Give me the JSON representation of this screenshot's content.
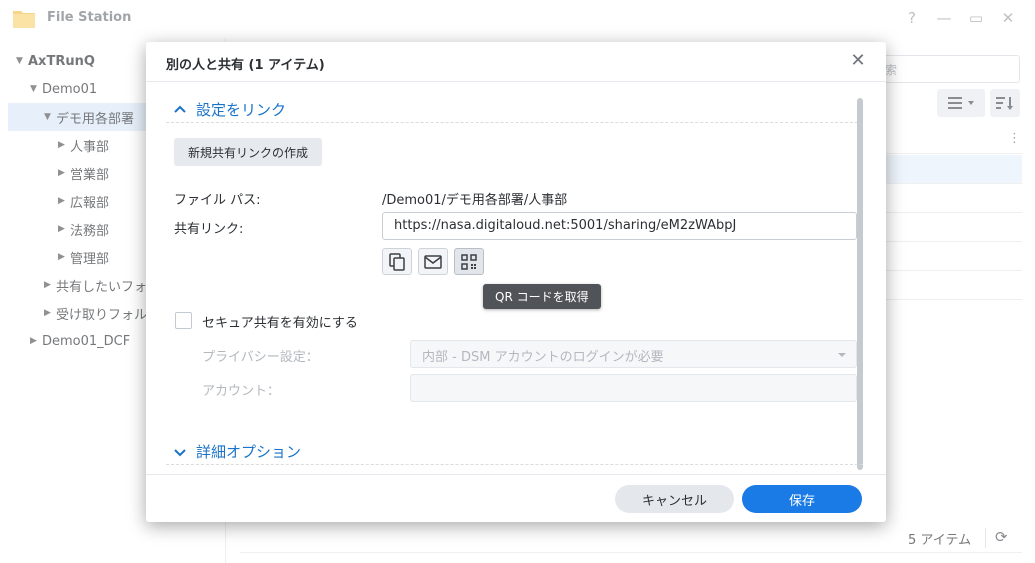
{
  "app": {
    "title": "File Station",
    "icon": "folder-icon"
  },
  "window_controls": [
    "?",
    "—",
    "▭",
    "✕"
  ],
  "sidebar": {
    "root": "AxTRunQ",
    "items": [
      {
        "label": "Demo01",
        "level": 1,
        "expanded": true
      },
      {
        "label": "デモ用各部署",
        "level": 2,
        "expanded": true,
        "selected": true
      },
      {
        "label": "人事部",
        "level": 3
      },
      {
        "label": "営業部",
        "level": 3
      },
      {
        "label": "広報部",
        "level": 3
      },
      {
        "label": "法務部",
        "level": 3
      },
      {
        "label": "管理部",
        "level": 3
      },
      {
        "label": "共有したいフォ",
        "level": 2
      },
      {
        "label": "受け取りフォル",
        "level": 2
      },
      {
        "label": "Demo01_DCF",
        "level": 1
      }
    ]
  },
  "background": {
    "search_placeholder": "索",
    "status_count": "5 アイテム"
  },
  "dialog": {
    "title": "別の人と共有 (1 アイテム)",
    "section_link": "設定をリンク",
    "create_link_button": "新規共有リンクの作成",
    "file_path_label": "ファイル パス:",
    "file_path_value": "/Demo01/デモ用各部署/人事部",
    "share_link_label": "共有リンク:",
    "share_link_value": "https://nasa.digitaloud.net:5001/sharing/eM2zWAbpJ",
    "tooltip": "QR コードを取得",
    "secure_share_label": "セキュア共有を有効にする",
    "privacy_label": "プライバシー設定：",
    "privacy_value": "内部 - DSM アカウントのログインが必要",
    "account_label": "アカウント：",
    "section_advanced": "詳細オプション",
    "cancel_button": "キャンセル",
    "save_button": "保存"
  },
  "colors": {
    "accent": "#1a7ae6",
    "link_blue": "#1a73c8",
    "selection": "#dbe9f8"
  }
}
